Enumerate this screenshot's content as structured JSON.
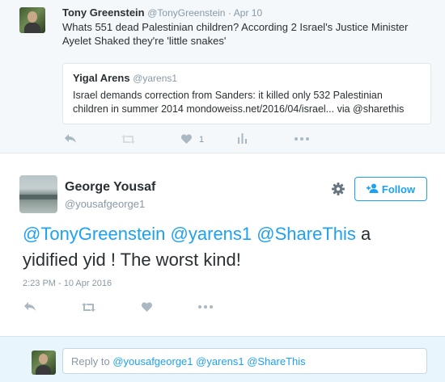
{
  "parent_tweet": {
    "author_name": "Tony Greenstein",
    "author_handle": "@TonyGreenstein",
    "date": "· Apr 10",
    "text_line1": "Whats 551 dead Palestinian children? According 2 Israel's Justice Minister",
    "text_line2": "Ayelet Shaked they're 'little snakes'",
    "quote": {
      "author_name": "Yigal Arens",
      "author_handle": "@yarens1",
      "text_line1": "Israel demands correction from Sanders: it killed only 532 Palestinian",
      "text_line2": "children in summer 2014 mondoweiss.net/2016/04/israel... via @sharethis"
    },
    "actions": {
      "like_count": "1"
    }
  },
  "main_tweet": {
    "author_name": "George Yousaf",
    "author_handle": "@yousafgeorge1",
    "follow_label": "Follow",
    "mention1": "@TonyGreenstein",
    "mention2": "@yarens1",
    "mention3": "@ShareThis",
    "text_after": " a",
    "text_line2": "yidified yid ! The worst kind!",
    "timestamp": "2:23 PM - 10 Apr 2016"
  },
  "reply": {
    "prefix": "Reply to ",
    "mentions": "@yousafgeorge1 @yarens1 @ShareThis"
  },
  "colors": {
    "accent": "#1da1f2",
    "muted": "#8899a6",
    "icon": "#aab8c2"
  },
  "icons": [
    "reply-icon",
    "retweet-icon",
    "like-icon",
    "analytics-icon",
    "more-icon",
    "gear-icon",
    "add-user-icon"
  ]
}
